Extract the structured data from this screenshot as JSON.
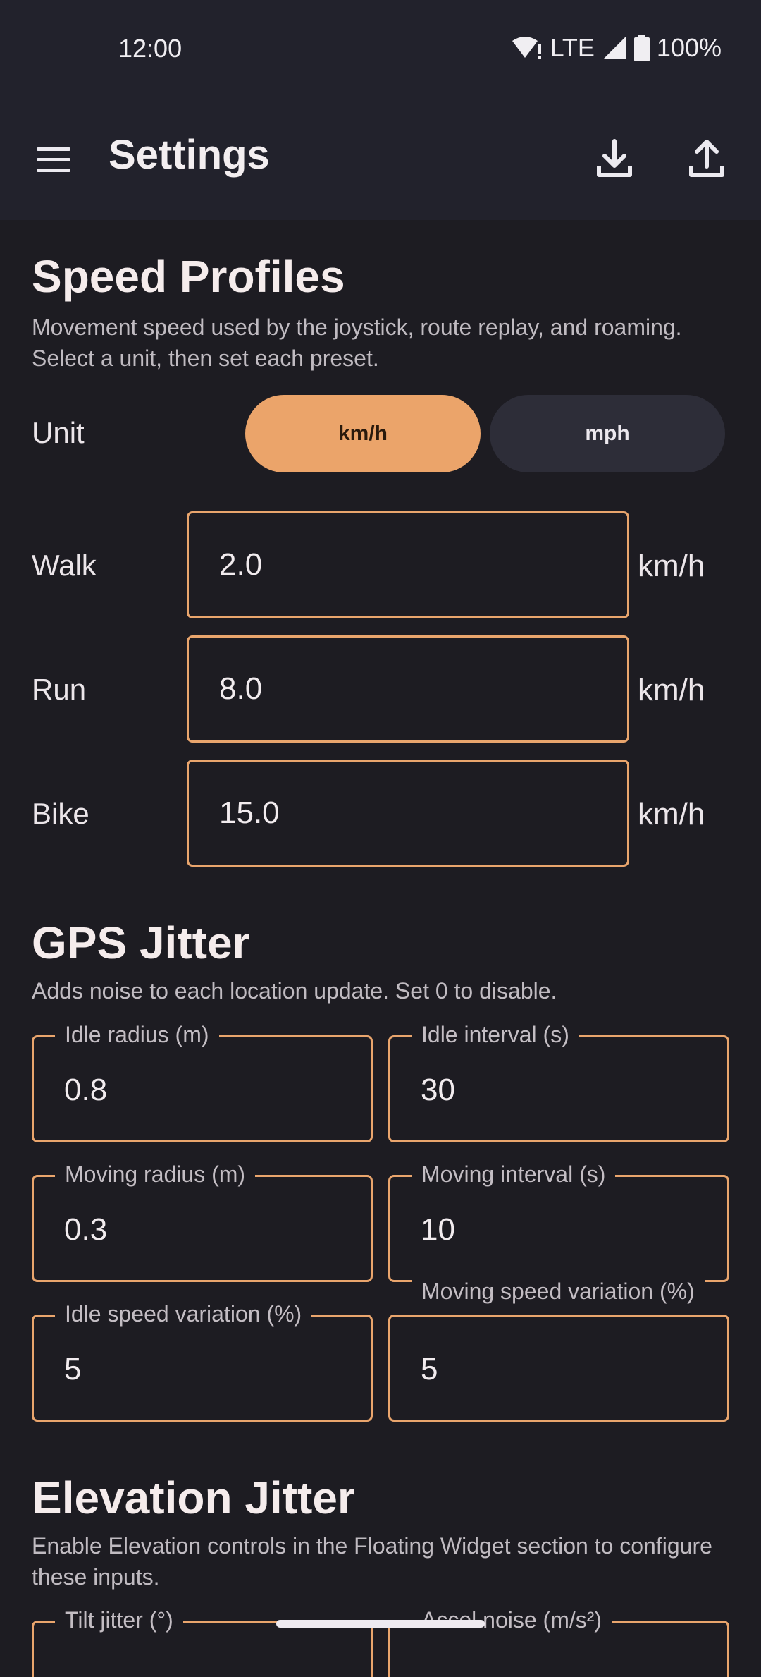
{
  "status": {
    "time": "12:00",
    "network": "LTE",
    "battery": "100%"
  },
  "appbar": {
    "title": "Settings"
  },
  "speed_profiles": {
    "title": "Speed Profiles",
    "description": "Movement speed used by the joystick, route replay, and roaming. Select a unit, then set each preset.",
    "unit_label": "Unit",
    "unit_options": [
      "km/h",
      "mph"
    ],
    "selected_unit": "km/h",
    "presets": [
      {
        "label": "Walk",
        "value": "2.0",
        "unit": "km/h"
      },
      {
        "label": "Run",
        "value": "8.0",
        "unit": "km/h"
      },
      {
        "label": "Bike",
        "value": "15.0",
        "unit": "km/h"
      }
    ]
  },
  "gps_jitter": {
    "title": "GPS Jitter",
    "description": "Adds noise to each location update. Set 0 to disable.",
    "fields": [
      {
        "label": "Idle radius (m)",
        "value": "0.8"
      },
      {
        "label": "Idle interval (s)",
        "value": "30"
      },
      {
        "label": "Moving radius (m)",
        "value": "0.3"
      },
      {
        "label": "Moving interval (s)",
        "value": "10"
      },
      {
        "label": "Idle speed variation (%)",
        "value": "5"
      },
      {
        "label": "Moving speed variation (%)",
        "value": "5"
      }
    ]
  },
  "elevation_jitter": {
    "title": "Elevation Jitter",
    "description": "Enable Elevation controls in the Floating Widget section to configure these inputs.",
    "fields": [
      {
        "label": "Tilt jitter (°)"
      },
      {
        "label": "Accel noise (m/s²)"
      }
    ]
  },
  "colors": {
    "accent": "#eba46a",
    "background": "#1d1c22",
    "bar": "#22222c"
  }
}
